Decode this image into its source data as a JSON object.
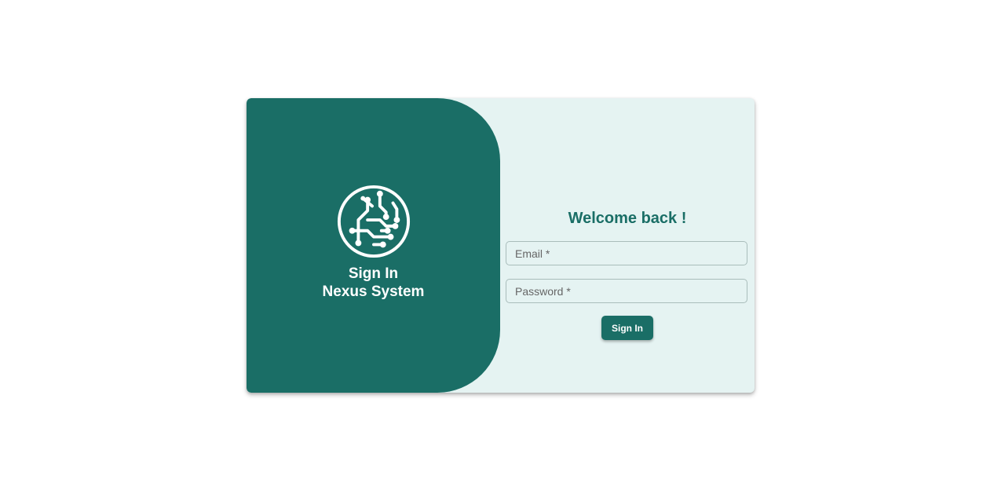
{
  "brand": {
    "logo_icon": "circuit-globe-icon",
    "title_line1": "Sign In",
    "title_line2": "Nexus System"
  },
  "form": {
    "heading": "Welcome back !",
    "email_placeholder": "Email *",
    "password_placeholder": "Password *",
    "submit_label": "Sign In"
  },
  "colors": {
    "primary": "#1a6e66",
    "form_background": "#e5f3f2",
    "page_background": "#ffffff"
  }
}
